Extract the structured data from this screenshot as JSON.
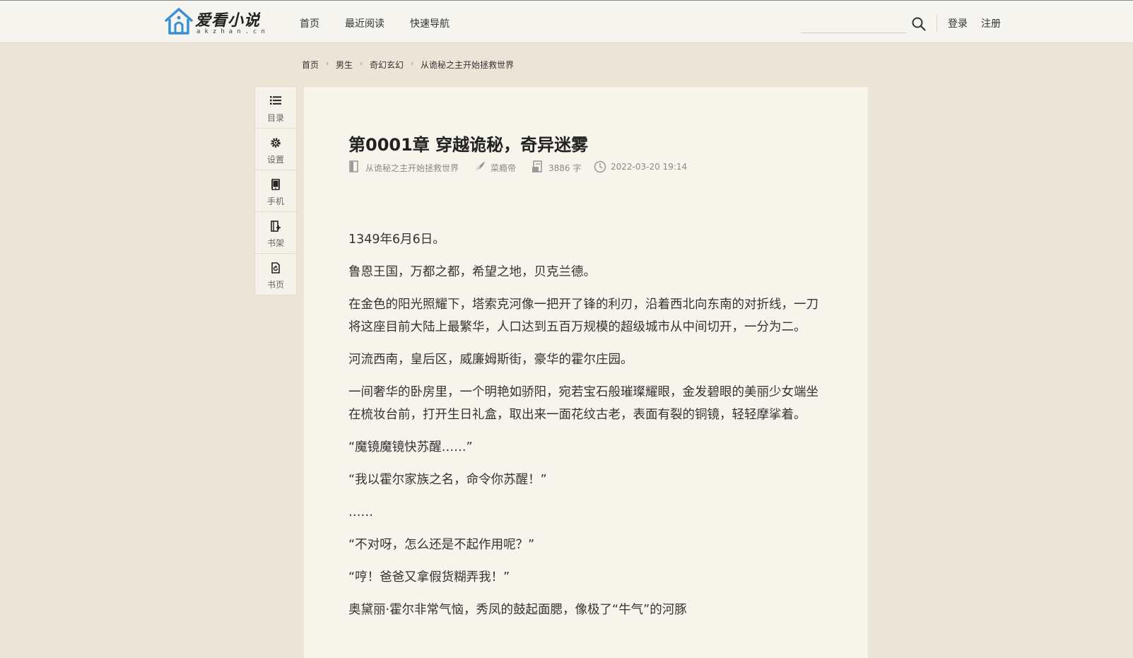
{
  "site": {
    "logo_text": "爱看小说",
    "logo_sub": "akzhan.cn"
  },
  "nav": {
    "home": "首页",
    "recent": "最近阅读",
    "quick": "快速导航"
  },
  "search": {
    "placeholder": ""
  },
  "auth": {
    "login": "登录",
    "register": "注册"
  },
  "breadcrumb": [
    "首页",
    "男生",
    "奇幻玄幻",
    "从诡秘之主开始拯救世界"
  ],
  "sidebar": {
    "items": [
      {
        "label": "目录",
        "icon": "list-icon"
      },
      {
        "label": "设置",
        "icon": "gear-icon"
      },
      {
        "label": "手机",
        "icon": "phone-icon"
      },
      {
        "label": "书架",
        "icon": "bookshelf-add-icon"
      },
      {
        "label": "书页",
        "icon": "book-page-icon"
      }
    ]
  },
  "chapter": {
    "title": "第0001章 穿越诡秘，奇异迷雾",
    "book": "从诡秘之主开始拯救世界",
    "author": "菜瘾帝",
    "words": "3886 字",
    "updated": "2022-03-20 19:14"
  },
  "paragraphs": [
    "1349年6月6日。",
    "鲁恩王国，万都之都，希望之地，贝克兰德。",
    "在金色的阳光照耀下，塔索克河像一把开了锋的利刃，沿着西北向东南的对折线，一刀将这座目前大陆上最繁华，人口达到五百万规模的超级城市从中间切开，一分为二。",
    "河流西南，皇后区，威廉姆斯街，豪华的霍尔庄园。",
    "一间奢华的卧房里，一个明艳如骄阳，宛若宝石般璀璨耀眼，金发碧眼的美丽少女端坐在梳妆台前，打开生日礼盒，取出来一面花纹古老，表面有裂的铜镜，轻轻摩挲着。",
    "“魔镜魔镜快苏醒……”",
    "“我以霍尔家族之名，命令你苏醒！”",
    "……",
    "“不对呀，怎么还是不起作用呢？”",
    "“哼！爸爸又拿假货糊弄我！”",
    "奥黛丽·霍尔非常气恼，秀凤的鼓起面腮，像极了“牛气”的河豚"
  ]
}
